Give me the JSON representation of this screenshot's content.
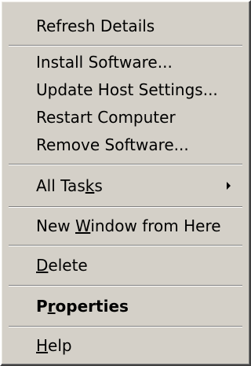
{
  "menu": {
    "items": {
      "refresh_details": "Refresh Details",
      "install_software": "Install Software...",
      "update_host_settings": "Update Host Settings...",
      "restart_computer": "Restart Computer",
      "remove_software": "Remove Software...",
      "all_tasks": {
        "before": "All Tas",
        "mnemonic": "k",
        "after": "s"
      },
      "new_window": {
        "before": "New ",
        "mnemonic": "W",
        "after": "indow from Here"
      },
      "delete": {
        "before": "",
        "mnemonic": "D",
        "after": "elete"
      },
      "properties": {
        "before": "P",
        "mnemonic": "r",
        "after": "operties"
      },
      "help": {
        "before": "",
        "mnemonic": "H",
        "after": "elp"
      }
    },
    "submenu_icon": "chevron-right-icon"
  }
}
